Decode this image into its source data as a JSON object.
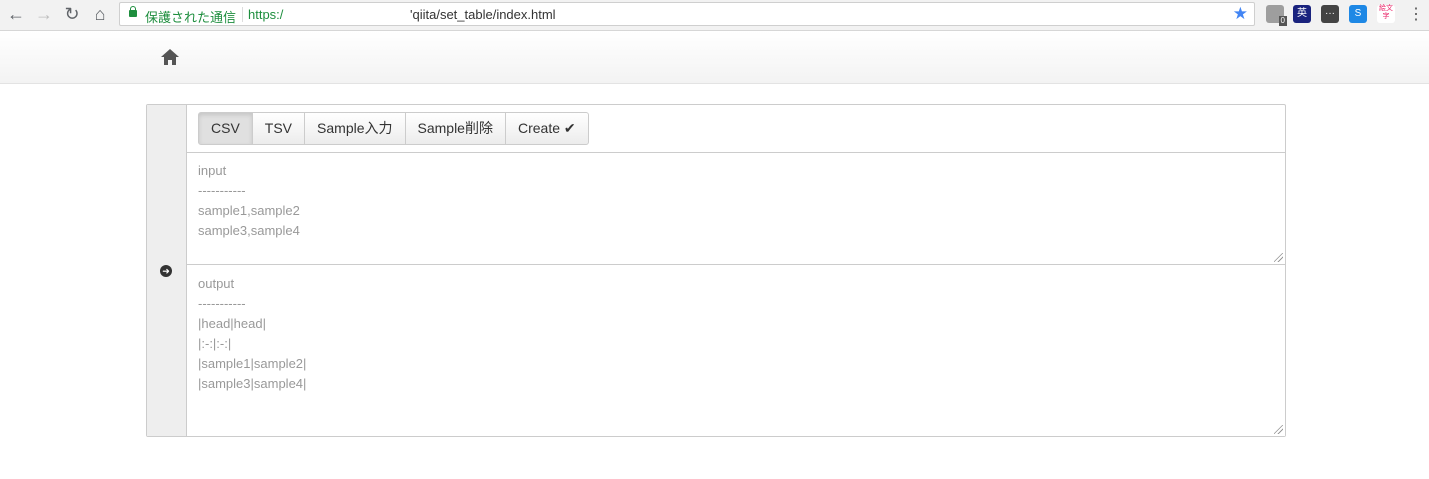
{
  "browser": {
    "secure_label": "保護された通信",
    "url_scheme": "https:/",
    "url_path": "'qiita/set_table/index.html",
    "ext_badge": "0",
    "ext_dict_label": "英",
    "ext_more_label": "···",
    "ext_s_label": "S",
    "ext_kanji_label": "絵文字",
    "menu_label": "⋮"
  },
  "toolbar": {
    "buttons": [
      "CSV",
      "TSV",
      "Sample入力",
      "Sample削除",
      "Create ✔"
    ],
    "active_index": 0
  },
  "input": {
    "lines": [
      "input",
      "-----------",
      "sample1,sample2",
      "sample3,sample4"
    ]
  },
  "output": {
    "lines": [
      "output",
      "-----------",
      "|head|head|",
      "|:-:|:-:|",
      "|sample1|sample2|",
      "|sample3|sample4|"
    ]
  },
  "icons": {
    "home": "home-icon",
    "convert": "arrow-right-circle-icon"
  }
}
